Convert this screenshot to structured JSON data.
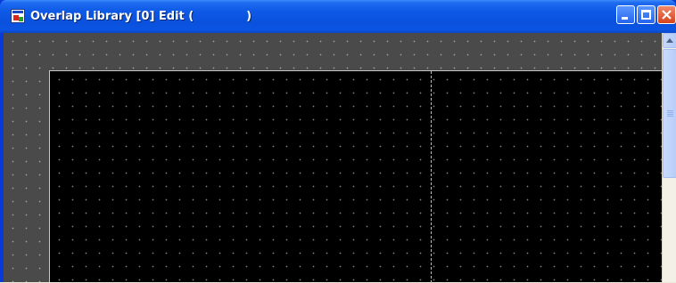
{
  "window": {
    "title": "Overlap Library [0] Edit (             )",
    "buttons": {
      "minimize": "minimize-icon",
      "maximize": "maximize-icon",
      "close": "close-icon"
    }
  },
  "colors": {
    "titlebar": "#0a51dd",
    "workspace": "#4a4a4a",
    "canvas": "#000000",
    "grid_dot": "#9a9a9a",
    "scrollbar_track": "#f3f1e7"
  },
  "icons": {
    "app": "overlap-library-app-icon",
    "scroll_up": "scroll-up-arrow-icon"
  }
}
